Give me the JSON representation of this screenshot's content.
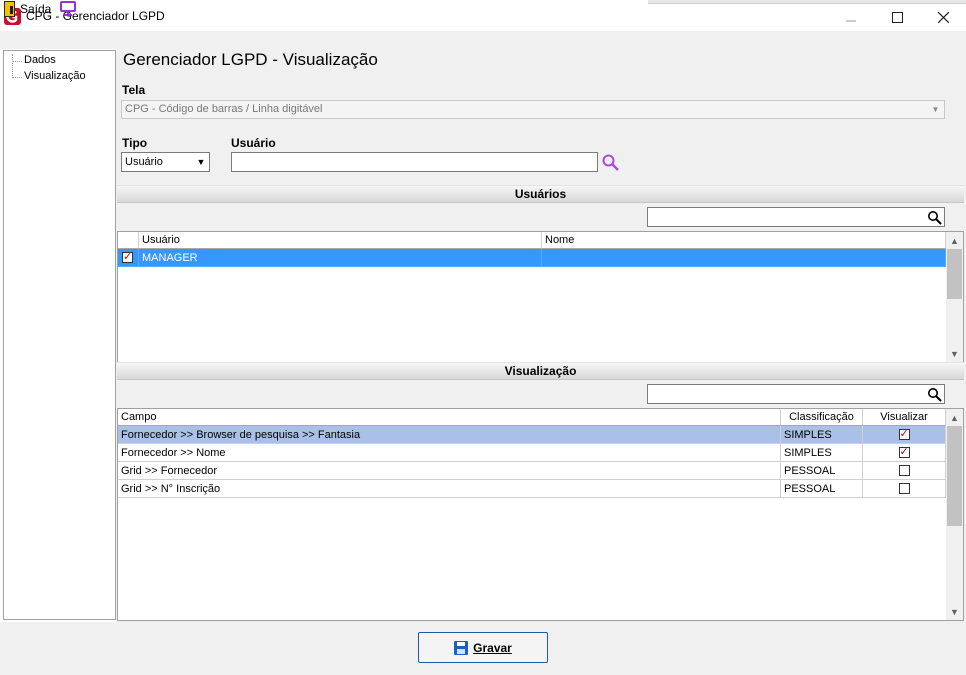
{
  "window": {
    "title": "CPG - Gerenciador LGPD",
    "brand_color": "#c8102e",
    "icons": [
      "minimize-icon",
      "maximize-icon",
      "close-icon"
    ]
  },
  "menu": {
    "exit_label": "Saída",
    "icons": [
      "exit-door-icon",
      "monitor-icon"
    ]
  },
  "tree": {
    "items": [
      "Dados",
      "Visualização"
    ]
  },
  "page": {
    "title": "Gerenciador LGPD - Visualização"
  },
  "form": {
    "tela_label": "Tela",
    "tela_value": "CPG - Código de barras / Linha digitável",
    "tipo_label": "Tipo",
    "tipo_value": "Usuário",
    "usuario_label": "Usuário",
    "usuario_value": ""
  },
  "usuarios": {
    "header": "Usuários",
    "filter_value": "",
    "columns": [
      "Usuário",
      "Nome"
    ],
    "rows": [
      {
        "checked": true,
        "usuario": "MANAGER",
        "nome": ""
      }
    ],
    "selected_color": "#3399ff"
  },
  "visualizacao": {
    "header": "Visualização",
    "filter_value": "",
    "columns": [
      "Campo",
      "Classificação",
      "Visualizar"
    ],
    "rows": [
      {
        "campo": "Fornecedor >> Browser de pesquisa >> Fantasia",
        "classificacao": "SIMPLES",
        "visualizar": true
      },
      {
        "campo": "Fornecedor >> Nome",
        "classificacao": "SIMPLES",
        "visualizar": true
      },
      {
        "campo": "Grid >> Fornecedor",
        "classificacao": "PESSOAL",
        "visualizar": false
      },
      {
        "campo": "Grid >> N° Inscrição",
        "classificacao": "PESSOAL",
        "visualizar": false
      }
    ],
    "selected_color": "#a9c0e8"
  },
  "footer": {
    "save_label": "Gravar",
    "save_icon": "floppy-disk-icon"
  }
}
